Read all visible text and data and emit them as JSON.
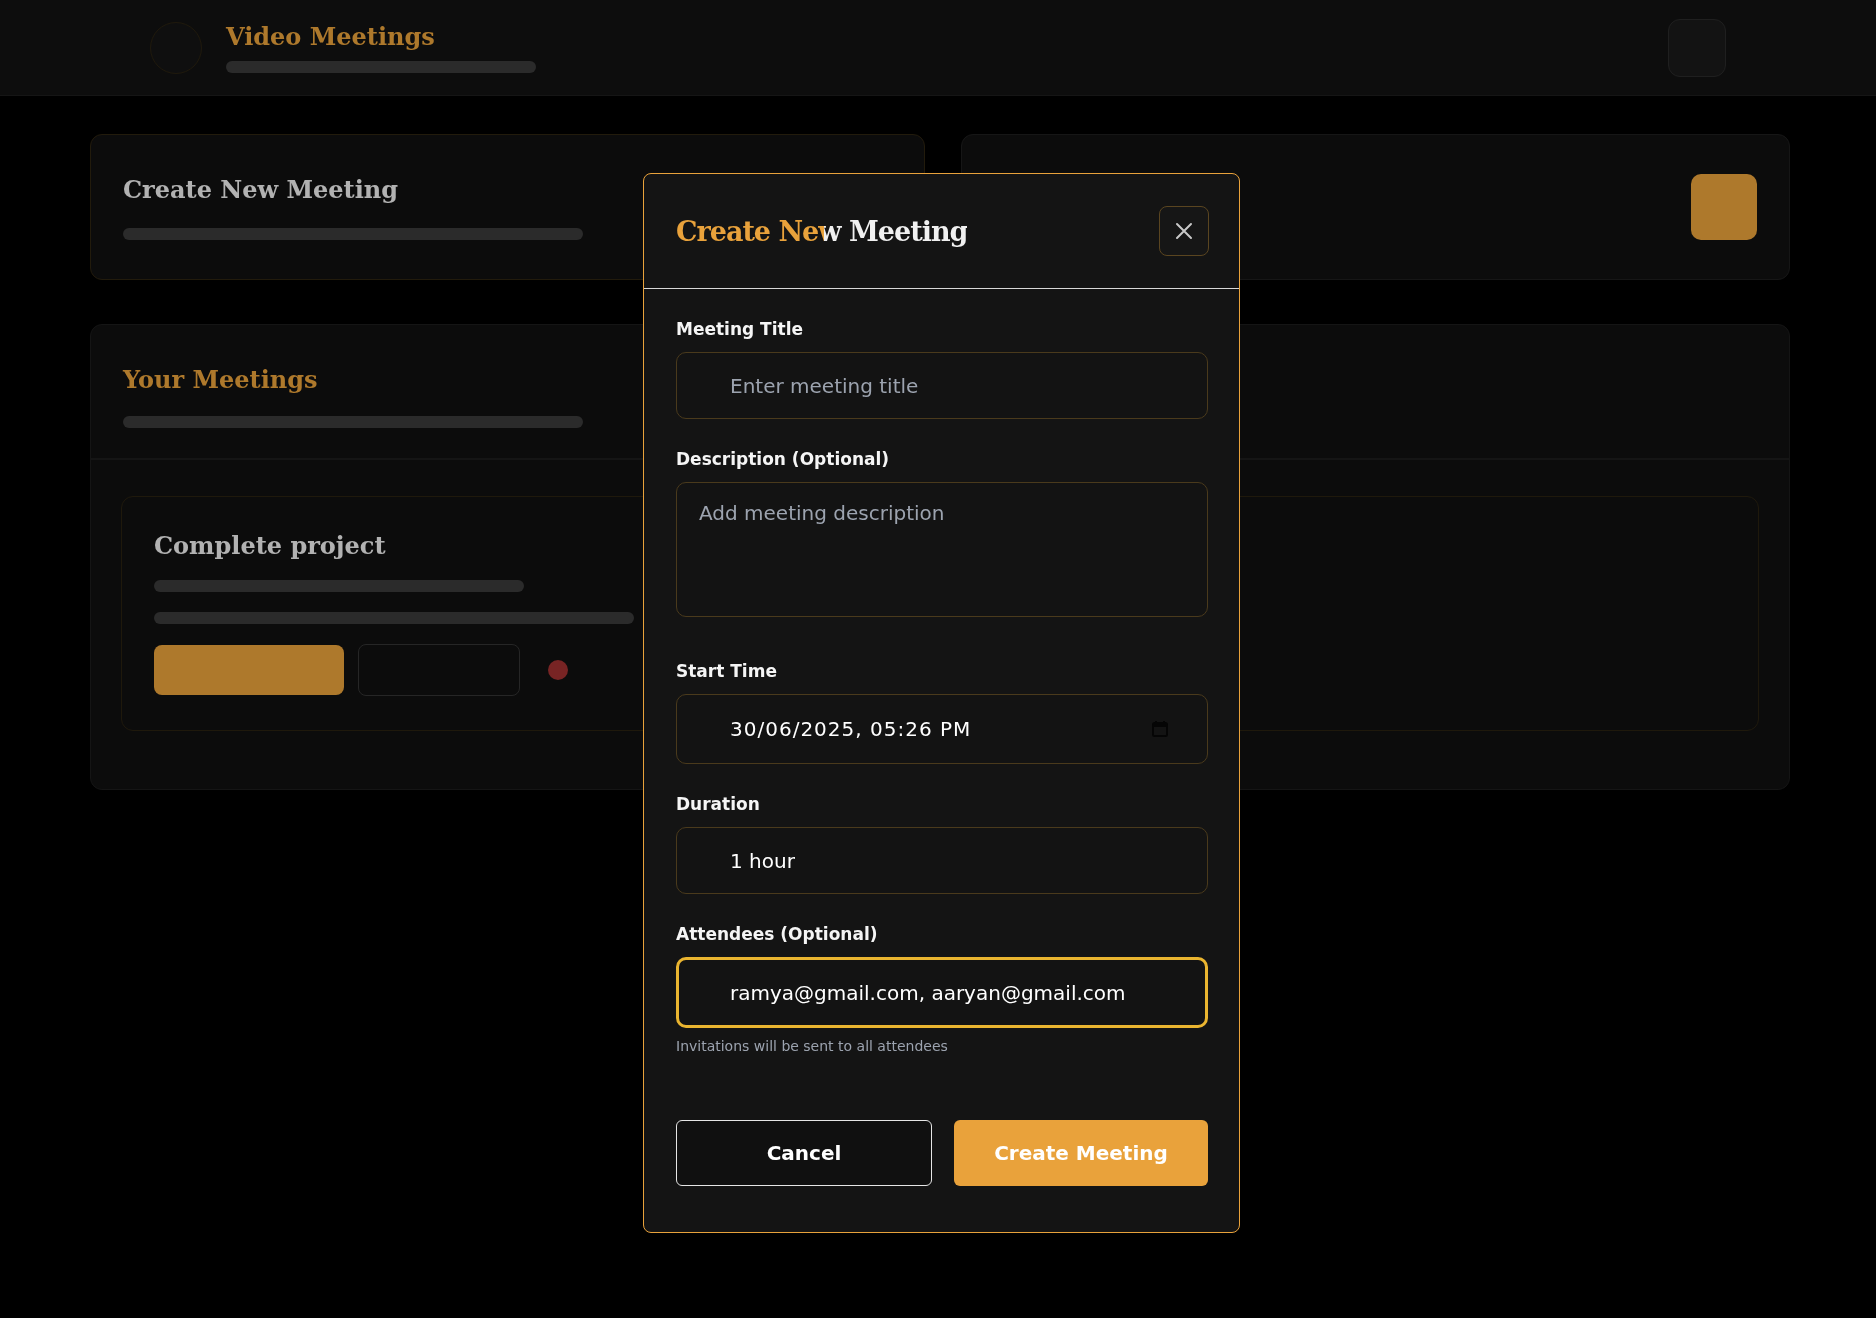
{
  "background": {
    "header": {
      "title": "Video Meetings"
    },
    "create_card": {
      "title": "Create New Meeting"
    },
    "meetings_panel": {
      "title": "Your Meetings",
      "meetings": [
        {
          "title": "Complete project"
        }
      ]
    }
  },
  "dialog": {
    "title": "Create New Meeting",
    "fields": [
      {
        "label": "Meeting Title",
        "kind": "text",
        "placeholder": "Enter meeting title",
        "focused": false
      },
      {
        "label": "Description (Optional)",
        "kind": "textarea",
        "placeholder": "Add meeting description",
        "focused": false
      },
      {
        "label": "Start Time",
        "kind": "datetime",
        "value": "30/06/2025, 05:26 PM",
        "focused": false
      },
      {
        "label": "Duration",
        "kind": "select",
        "value": "1 hour",
        "focused": false
      },
      {
        "label": "Attendees (Optional)",
        "kind": "text",
        "value": "ramya@gmail.com, aaryan@gmail.com",
        "focused": true,
        "hint": "Invitations will be sent to all attendees"
      }
    ],
    "buttons": [
      {
        "label": "Cancel",
        "kind": "secondary"
      },
      {
        "label": "Create Meeting",
        "kind": "primary"
      }
    ]
  }
}
